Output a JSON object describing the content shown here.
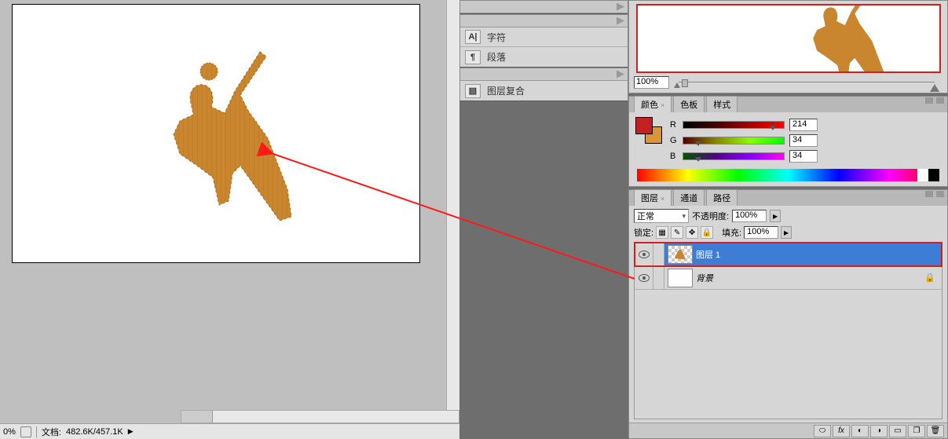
{
  "status": {
    "zoom": "0%",
    "docLabel": "文档:",
    "docInfo": "482.6K/457.1K"
  },
  "midPanels": {
    "char": "字符",
    "para": "段落",
    "layerComp": "图层复合"
  },
  "navigator": {
    "zoomValue": "100%"
  },
  "colorPanel": {
    "tabs": {
      "color": "颜色",
      "swatches": "色板",
      "styles": "样式"
    },
    "r": {
      "label": "R",
      "value": "214"
    },
    "g": {
      "label": "G",
      "value": "34"
    },
    "b": {
      "label": "B",
      "value": "34"
    }
  },
  "layersPanel": {
    "tabs": {
      "layers": "图层",
      "channels": "通道",
      "paths": "路径"
    },
    "blendMode": "正常",
    "opacityLabel": "不透明度:",
    "opacityValue": "100%",
    "lockLabel": "锁定:",
    "fillLabel": "填充:",
    "fillValue": "100%",
    "layer1": "图层 1",
    "background": "背景"
  }
}
